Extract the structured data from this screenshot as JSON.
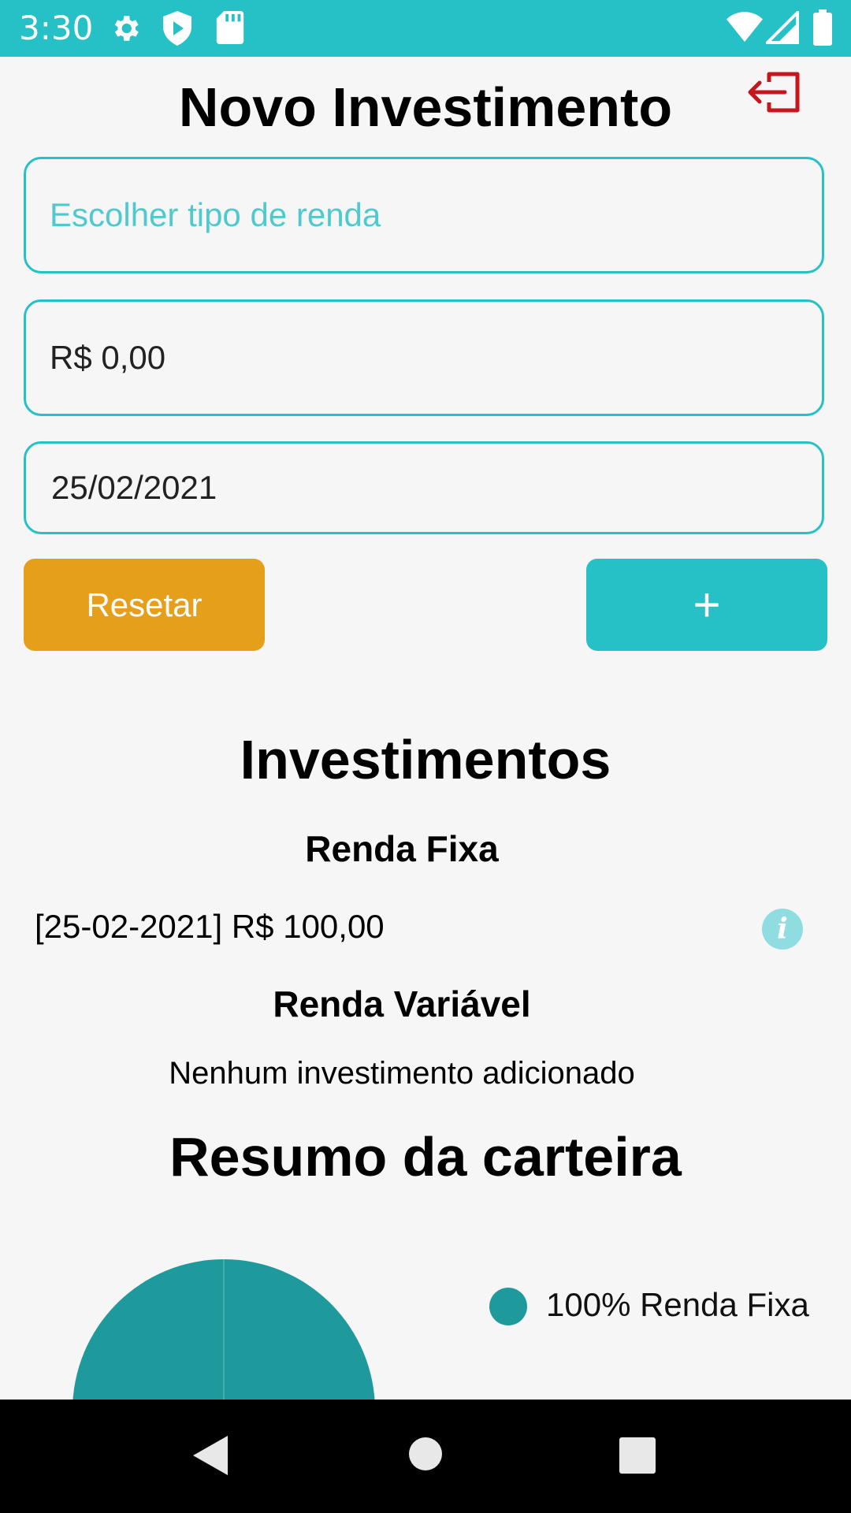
{
  "status_bar": {
    "time": "3:30",
    "icons": [
      "gear-icon",
      "play-protect-icon",
      "sd-card-icon",
      "wifi-icon",
      "signal-icon",
      "battery-icon"
    ]
  },
  "header": {
    "title": "Novo Investimento",
    "logout_icon": "logout-icon"
  },
  "form": {
    "type_placeholder": "Escolher tipo de renda",
    "amount_value": "R$ 0,00",
    "date_value": "25/02/2021",
    "reset_label": "Resetar",
    "add_label": "+"
  },
  "investments": {
    "title": "Investimentos",
    "fixed": {
      "title": "Renda Fixa",
      "items": [
        {
          "text": "[25-02-2021] R$ 100,00",
          "icon": "info-icon"
        }
      ]
    },
    "variable": {
      "title": "Renda Variável",
      "empty_text": "Nenhum investimento adicionado"
    }
  },
  "summary": {
    "title": "Resumo da carteira",
    "legend": [
      {
        "label": "100% Renda Fixa",
        "color": "#1e9a9c"
      }
    ]
  },
  "chart_data": {
    "type": "pie",
    "categories": [
      "Renda Fixa"
    ],
    "values": [
      100
    ],
    "colors": [
      "#1e9a9c"
    ]
  },
  "colors": {
    "accent": "#26c1c7",
    "reset": "#e69f1b",
    "logout": "#c4161c"
  }
}
